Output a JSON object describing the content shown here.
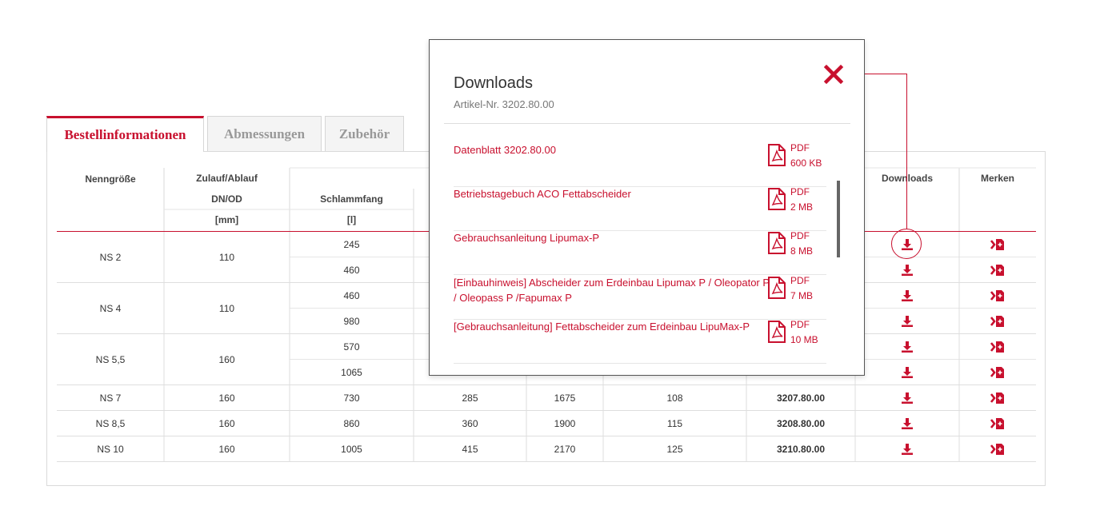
{
  "tabs": [
    {
      "label": "Bestellinformationen",
      "active": true
    },
    {
      "label": "Abmessungen",
      "active": false
    },
    {
      "label": "Zubehör",
      "active": false
    }
  ],
  "table": {
    "headers": {
      "nenngroesse": "Nenngröße",
      "zulauf": "Zulauf/Ablauf",
      "dnod": "DN/OD",
      "mm": "[mm]",
      "schlammfang": "Schlammfang",
      "liter": "[l]",
      "downloads": "Downloads",
      "merken": "Merken"
    },
    "groups": [
      {
        "ns": "NS 2",
        "dn": "110",
        "rows": [
          {
            "schlamm": "245",
            "c4": "",
            "c5": "",
            "c6": "",
            "art": ""
          },
          {
            "schlamm": "460",
            "c4": "",
            "c5": "",
            "c6": "",
            "art": ""
          }
        ]
      },
      {
        "ns": "NS 4",
        "dn": "110",
        "rows": [
          {
            "schlamm": "460",
            "c4": "",
            "c5": "",
            "c6": "",
            "art": ""
          },
          {
            "schlamm": "980",
            "c4": "",
            "c5": "",
            "c6": "",
            "art": ""
          }
        ]
      },
      {
        "ns": "NS 5,5",
        "dn": "160",
        "rows": [
          {
            "schlamm": "570",
            "c4": "",
            "c5": "",
            "c6": "",
            "art": ""
          },
          {
            "schlamm": "1065",
            "c4": "",
            "c5": "",
            "c6": "",
            "art": ""
          }
        ]
      },
      {
        "ns": "NS 7",
        "dn": "160",
        "rows": [
          {
            "schlamm": "730",
            "c4": "285",
            "c5": "1675",
            "c6": "108",
            "art": "3207.80.00"
          }
        ]
      },
      {
        "ns": "NS 8,5",
        "dn": "160",
        "rows": [
          {
            "schlamm": "860",
            "c4": "360",
            "c5": "1900",
            "c6": "115",
            "art": "3208.80.00"
          }
        ]
      },
      {
        "ns": "NS 10",
        "dn": "160",
        "rows": [
          {
            "schlamm": "1005",
            "c4": "415",
            "c5": "2170",
            "c6": "125",
            "art": "3210.80.00"
          }
        ]
      }
    ]
  },
  "modal": {
    "title": "Downloads",
    "subtitle": "Artikel-Nr. 3202.80.00",
    "items": [
      {
        "title": "Datenblatt 3202.80.00",
        "type": "PDF",
        "size": "600 KB"
      },
      {
        "title": "Betriebstagebuch ACO Fettabscheider",
        "type": "PDF",
        "size": "2 MB"
      },
      {
        "title": "Gebrauchsanleitung Lipumax-P",
        "type": "PDF",
        "size": "8 MB"
      },
      {
        "title": "[Einbauhinweis] Abscheider zum Erdeinbau Lipumax P / Oleopator P / Oleopass P /Fapumax P",
        "type": "PDF",
        "size": "7 MB"
      },
      {
        "title": "[Gebrauchsanleitung] Fettabscheider zum Erdeinbau LipuMax-P",
        "type": "PDF",
        "size": "10 MB"
      }
    ]
  },
  "colors": {
    "accent": "#c8102e",
    "border": "#dadada",
    "text": "#333333"
  },
  "icons": {
    "download": "download-icon",
    "merken": "bookmark-add-icon",
    "close": "close-icon",
    "pdf": "pdf-file-icon"
  }
}
